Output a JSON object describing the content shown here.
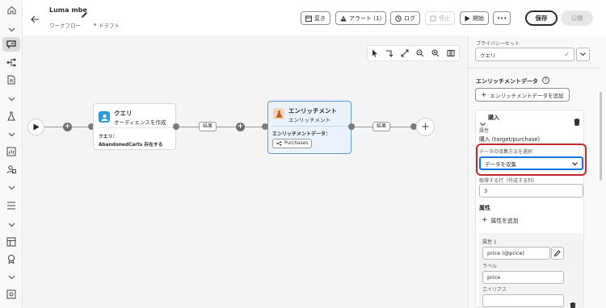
{
  "header": {
    "title": "Luma mbe",
    "breadcrumb": "ワークフロー",
    "status": "ドラフト",
    "buttons": {
      "rename": "変き",
      "alerts": "アラート (1)",
      "log": "ログ",
      "stop": "停止",
      "start": "開始",
      "more": "•••",
      "save": "保存",
      "publish": "公開"
    }
  },
  "canvas": {
    "query_card": {
      "title": "クエリ",
      "subtitle": "オーディエンスを作成",
      "query_label": "クエリ：",
      "query_value": "AbandonedCarts 存在する"
    },
    "enrich_card": {
      "title": "エンリッチメント",
      "subtitle": "エンリッチメント",
      "data_label": "エンリッチメントデータ：",
      "chip": "Purchases"
    },
    "result_label_1": "結果",
    "result_label_2": "結果"
  },
  "panel": {
    "privacy_label": "プライバシーセット",
    "privacy_value": "クエリ",
    "enrichment_heading": "エンリッチメントデータ",
    "add_enrichment_button": "エンリッチメントデータを追加",
    "purchase_title": "購入",
    "attribute_label": "属性",
    "attribute_value": "購入 (target/purchase)",
    "collect_label": "データの収集方法を選択",
    "collect_value": "データを収集",
    "rows_label": "取得する行（作成する列）",
    "rows_value": "3",
    "attributes_heading": "属性",
    "add_attribute": "属性を追加",
    "attr1_label": "属性 1",
    "attr1_value": "price (@price)",
    "alias_label": "ラベル",
    "alias_value": "price",
    "alias2_label": "エイリアス"
  }
}
